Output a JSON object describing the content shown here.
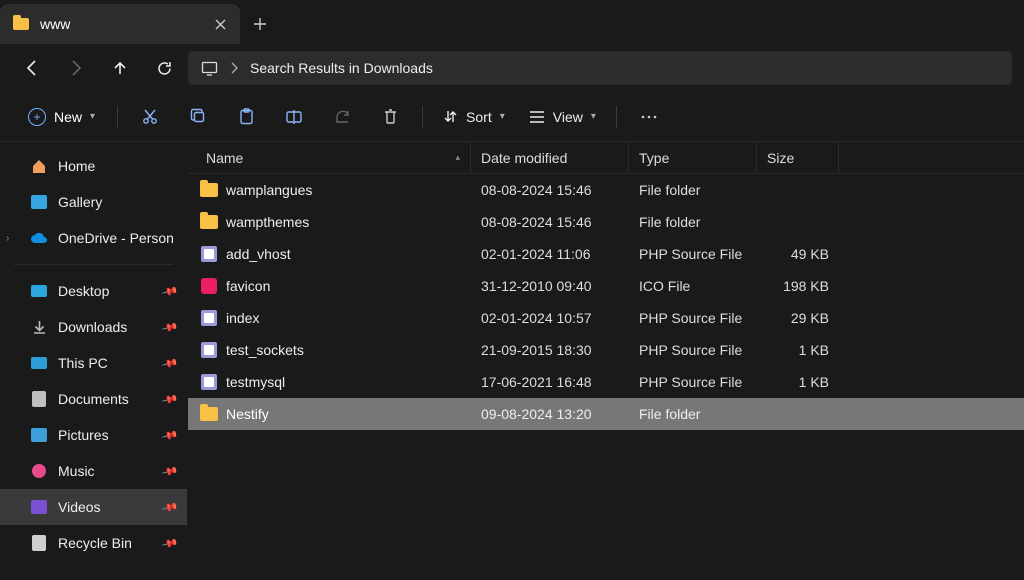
{
  "tab": {
    "title": "www"
  },
  "address": {
    "label": "Search Results in Downloads"
  },
  "toolbar": {
    "new_label": "New",
    "sort_label": "Sort",
    "view_label": "View"
  },
  "sidebar": {
    "home": "Home",
    "gallery": "Gallery",
    "onedrive": "OneDrive - Persona",
    "desktop": "Desktop",
    "downloads": "Downloads",
    "thispc": "This PC",
    "documents": "Documents",
    "pictures": "Pictures",
    "music": "Music",
    "videos": "Videos",
    "recycle": "Recycle Bin"
  },
  "columns": {
    "name": "Name",
    "date": "Date modified",
    "type": "Type",
    "size": "Size"
  },
  "rows": [
    {
      "icon": "folder",
      "name": "wamplangues",
      "date": "08-08-2024 15:46",
      "type": "File folder",
      "size": ""
    },
    {
      "icon": "folder",
      "name": "wampthemes",
      "date": "08-08-2024 15:46",
      "type": "File folder",
      "size": ""
    },
    {
      "icon": "php",
      "name": "add_vhost",
      "date": "02-01-2024 11:06",
      "type": "PHP Source File",
      "size": "49 KB"
    },
    {
      "icon": "ico",
      "name": "favicon",
      "date": "31-12-2010 09:40",
      "type": "ICO File",
      "size": "198 KB"
    },
    {
      "icon": "php",
      "name": "index",
      "date": "02-01-2024 10:57",
      "type": "PHP Source File",
      "size": "29 KB"
    },
    {
      "icon": "php",
      "name": "test_sockets",
      "date": "21-09-2015 18:30",
      "type": "PHP Source File",
      "size": "1 KB"
    },
    {
      "icon": "php",
      "name": "testmysql",
      "date": "17-06-2021 16:48",
      "type": "PHP Source File",
      "size": "1 KB"
    },
    {
      "icon": "folder",
      "name": "Nestify",
      "date": "09-08-2024 13:20",
      "type": "File folder",
      "size": "",
      "selected": true
    }
  ]
}
